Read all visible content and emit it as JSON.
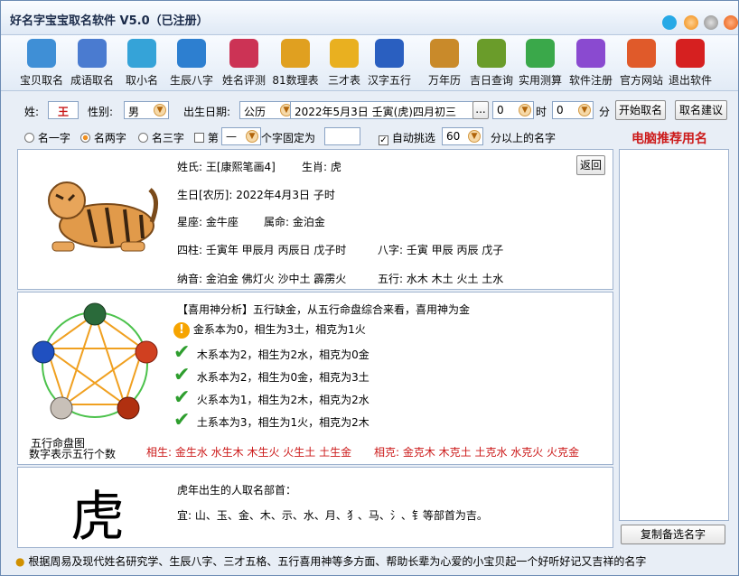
{
  "window": {
    "title": "好名字宝宝取名软件 V5.0（已注册）"
  },
  "toolbar": [
    {
      "label": "宝贝取名",
      "icon": "baby-name-icon",
      "color": "#3f8fd6"
    },
    {
      "label": "成语取名",
      "icon": "idiom-name-icon",
      "color": "#4a7bd0"
    },
    {
      "label": "取小名",
      "icon": "nickname-icon",
      "color": "#35a3d8"
    },
    {
      "label": "生辰八字",
      "icon": "bazi-icon",
      "color": "#2d7fd0"
    },
    {
      "label": "姓名评测",
      "icon": "name-evaluation-icon",
      "color": "#cc3355"
    },
    {
      "label": "81数理表",
      "icon": "table-81-icon",
      "color": "#e0a020"
    },
    {
      "label": "三才表",
      "icon": "sancai-icon",
      "color": "#e9b020"
    },
    {
      "label": "汉字五行",
      "icon": "hanzi-wuxing-icon",
      "color": "#2a5fc0"
    },
    {
      "label": "万年历",
      "icon": "calendar-icon",
      "color": "#c98a2a"
    },
    {
      "label": "吉日查询",
      "icon": "lucky-day-icon",
      "color": "#6a9c2a"
    },
    {
      "label": "实用测算",
      "icon": "calculation-icon",
      "color": "#3aa84a"
    },
    {
      "label": "软件注册",
      "icon": "register-icon",
      "color": "#8a4ad0"
    },
    {
      "label": "官方网站",
      "icon": "website-icon",
      "color": "#e05a2a"
    },
    {
      "label": "退出软件",
      "icon": "exit-icon",
      "color": "#d62020"
    }
  ],
  "form": {
    "surname_label": "姓:",
    "surname": "王",
    "gender_label": "性别:",
    "gender": "男",
    "birth_label": "出生日期:",
    "calendar": "公历",
    "birth_value": "2022年5月3日 壬寅(虎)四月初三",
    "ellipsis": "...",
    "hour": "0",
    "hour_unit": "时",
    "minute": "0",
    "minute_unit": "分",
    "start_button": "开始取名",
    "suggest_button": "取名建议",
    "opt_one": "名一字",
    "opt_two": "名两字",
    "opt_three": "名三字",
    "fixed_prefix": "第",
    "fixed_pos": "—",
    "fixed_suffix": "个字固定为",
    "auto_label": "自动挑选",
    "auto_score": "60",
    "auto_suffix": "分以上的名字",
    "recommend_title": "电脑推荐用名"
  },
  "info": {
    "surname_line": "姓氏: 王[康熙笔画4]",
    "zodiac_line": "生肖: 虎",
    "lunar_line": "生日[农历]: 2022年4月3日   子时",
    "star_line": "星座: 金牛座",
    "ming_line": "属命: 金泊金",
    "sizhu_line": "四柱: 壬寅年  甲辰月  丙辰日  戊子时",
    "bazi_line": "八字: 壬寅  甲辰  丙辰  戊子",
    "nayin_line": "纳音: 金泊金  佛灯火  沙中土  霹雳火",
    "wuxing_line": "五行: 水木  木土  火土  土水",
    "back_button": "返回"
  },
  "analysis": {
    "title": "【喜用神分析】五行缺金，从五行命盘综合来看，喜用神为金",
    "lines": [
      "金系本为0，相生为3土，相克为1火",
      "木系本为2，相生为2水，相克为0金",
      "水系本为2，相生为0金，相克为3土",
      "火系本为1，相生为2木，相克为2水",
      "土系本为3，相生为1火，相克为2木"
    ],
    "sheng": "相生: 金生水  水生木  木生火  火生土  土生金",
    "ke": "相克: 金克木  木克土  土克水  水克火  火克金",
    "diagram_caption1": "五行命盘图",
    "diagram_caption2": "数字表示五行个数",
    "counts": {
      "wood": "2",
      "fire": "1",
      "earth": "3",
      "metal": "0",
      "water": "2"
    }
  },
  "radical": {
    "char": "虎",
    "title": "虎年出生的人取名部首：",
    "content": "宜: 山、玉、金、木、示、水、月、犭、马、氵、钅等部首为吉。"
  },
  "copy_button": "复制备选名字",
  "status": "根据周易及现代姓名研究学、生辰八字、三才五格、五行喜用神等多方面、帮助长辈为心爱的小宝贝起一个好听好记又吉祥的名字"
}
